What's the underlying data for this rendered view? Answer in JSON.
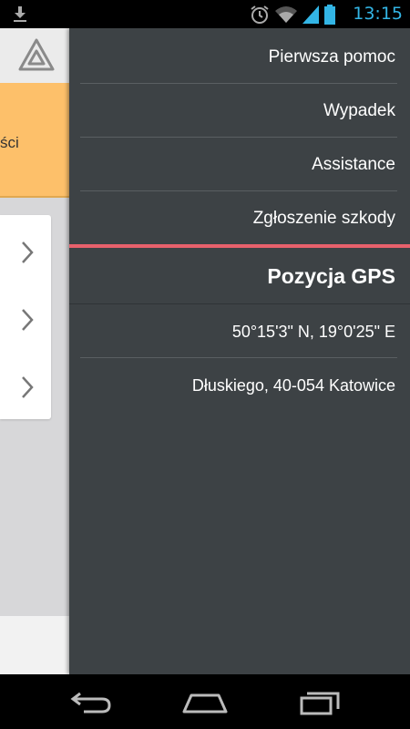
{
  "status_bar": {
    "time": "13:15",
    "icons": [
      "download-icon",
      "alarm-icon",
      "wifi-icon",
      "signal-icon",
      "battery-icon"
    ],
    "time_color": "#33b5e5"
  },
  "main": {
    "banner_text": "ści",
    "banner_color": "#fdc06a"
  },
  "drawer": {
    "menu": [
      {
        "label": "Pierwsza pomoc"
      },
      {
        "label": "Wypadek"
      },
      {
        "label": "Assistance"
      },
      {
        "label": "Zgłoszenie szkody"
      }
    ],
    "accent_color": "#e8616c",
    "gps": {
      "title": "Pozycja GPS",
      "coordinates": "50°15'3\"  N, 19°0'25\"  E",
      "address": "Dłuskiego, 40-054 Katowice"
    }
  },
  "nav_bar": {
    "buttons": [
      "back-icon",
      "home-icon",
      "recent-apps-icon"
    ]
  }
}
